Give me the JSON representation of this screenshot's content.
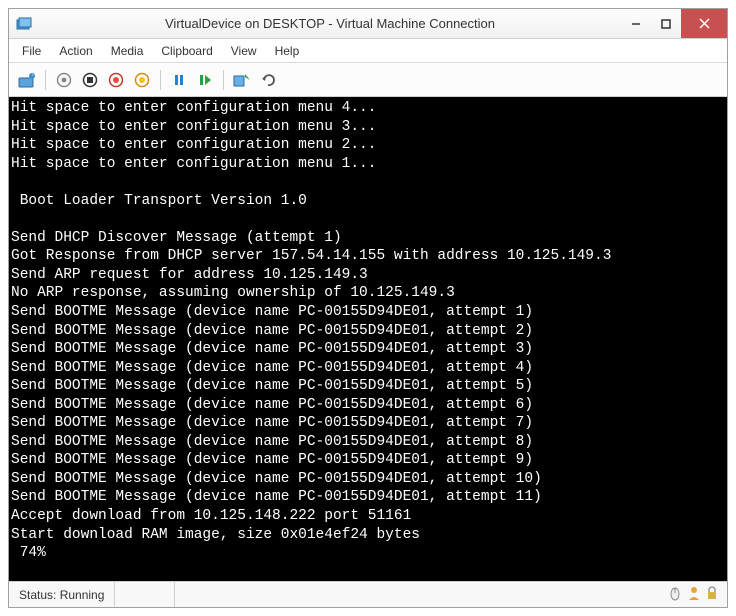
{
  "window": {
    "title": "VirtualDevice on DESKTOP - Virtual Machine Connection"
  },
  "menu": {
    "file": "File",
    "action": "Action",
    "media": "Media",
    "clipboard": "Clipboard",
    "view": "View",
    "help": "Help"
  },
  "toolbar_icons": {
    "ctrl_alt_del": "ctrl-alt-del-icon",
    "start": "start-icon",
    "turnoff": "turnoff-icon",
    "shutdown": "shutdown-icon",
    "save": "save-icon",
    "pause": "pause-icon",
    "reset": "reset-icon",
    "checkpoint": "checkpoint-icon",
    "revert": "revert-icon"
  },
  "console_lines": [
    "Hit space to enter configuration menu 4...",
    "Hit space to enter configuration menu 3...",
    "Hit space to enter configuration menu 2...",
    "Hit space to enter configuration menu 1...",
    "",
    " Boot Loader Transport Version 1.0",
    "",
    "Send DHCP Discover Message (attempt 1)",
    "Got Response from DHCP server 157.54.14.155 with address 10.125.149.3",
    "Send ARP request for address 10.125.149.3",
    "No ARP response, assuming ownership of 10.125.149.3",
    "Send BOOTME Message (device name PC-00155D94DE01, attempt 1)",
    "Send BOOTME Message (device name PC-00155D94DE01, attempt 2)",
    "Send BOOTME Message (device name PC-00155D94DE01, attempt 3)",
    "Send BOOTME Message (device name PC-00155D94DE01, attempt 4)",
    "Send BOOTME Message (device name PC-00155D94DE01, attempt 5)",
    "Send BOOTME Message (device name PC-00155D94DE01, attempt 6)",
    "Send BOOTME Message (device name PC-00155D94DE01, attempt 7)",
    "Send BOOTME Message (device name PC-00155D94DE01, attempt 8)",
    "Send BOOTME Message (device name PC-00155D94DE01, attempt 9)",
    "Send BOOTME Message (device name PC-00155D94DE01, attempt 10)",
    "Send BOOTME Message (device name PC-00155D94DE01, attempt 11)",
    "Accept download from 10.125.148.222 port 51161",
    "Start download RAM image, size 0x01e4ef24 bytes",
    " 74%"
  ],
  "status": {
    "label": "Status: Running"
  }
}
